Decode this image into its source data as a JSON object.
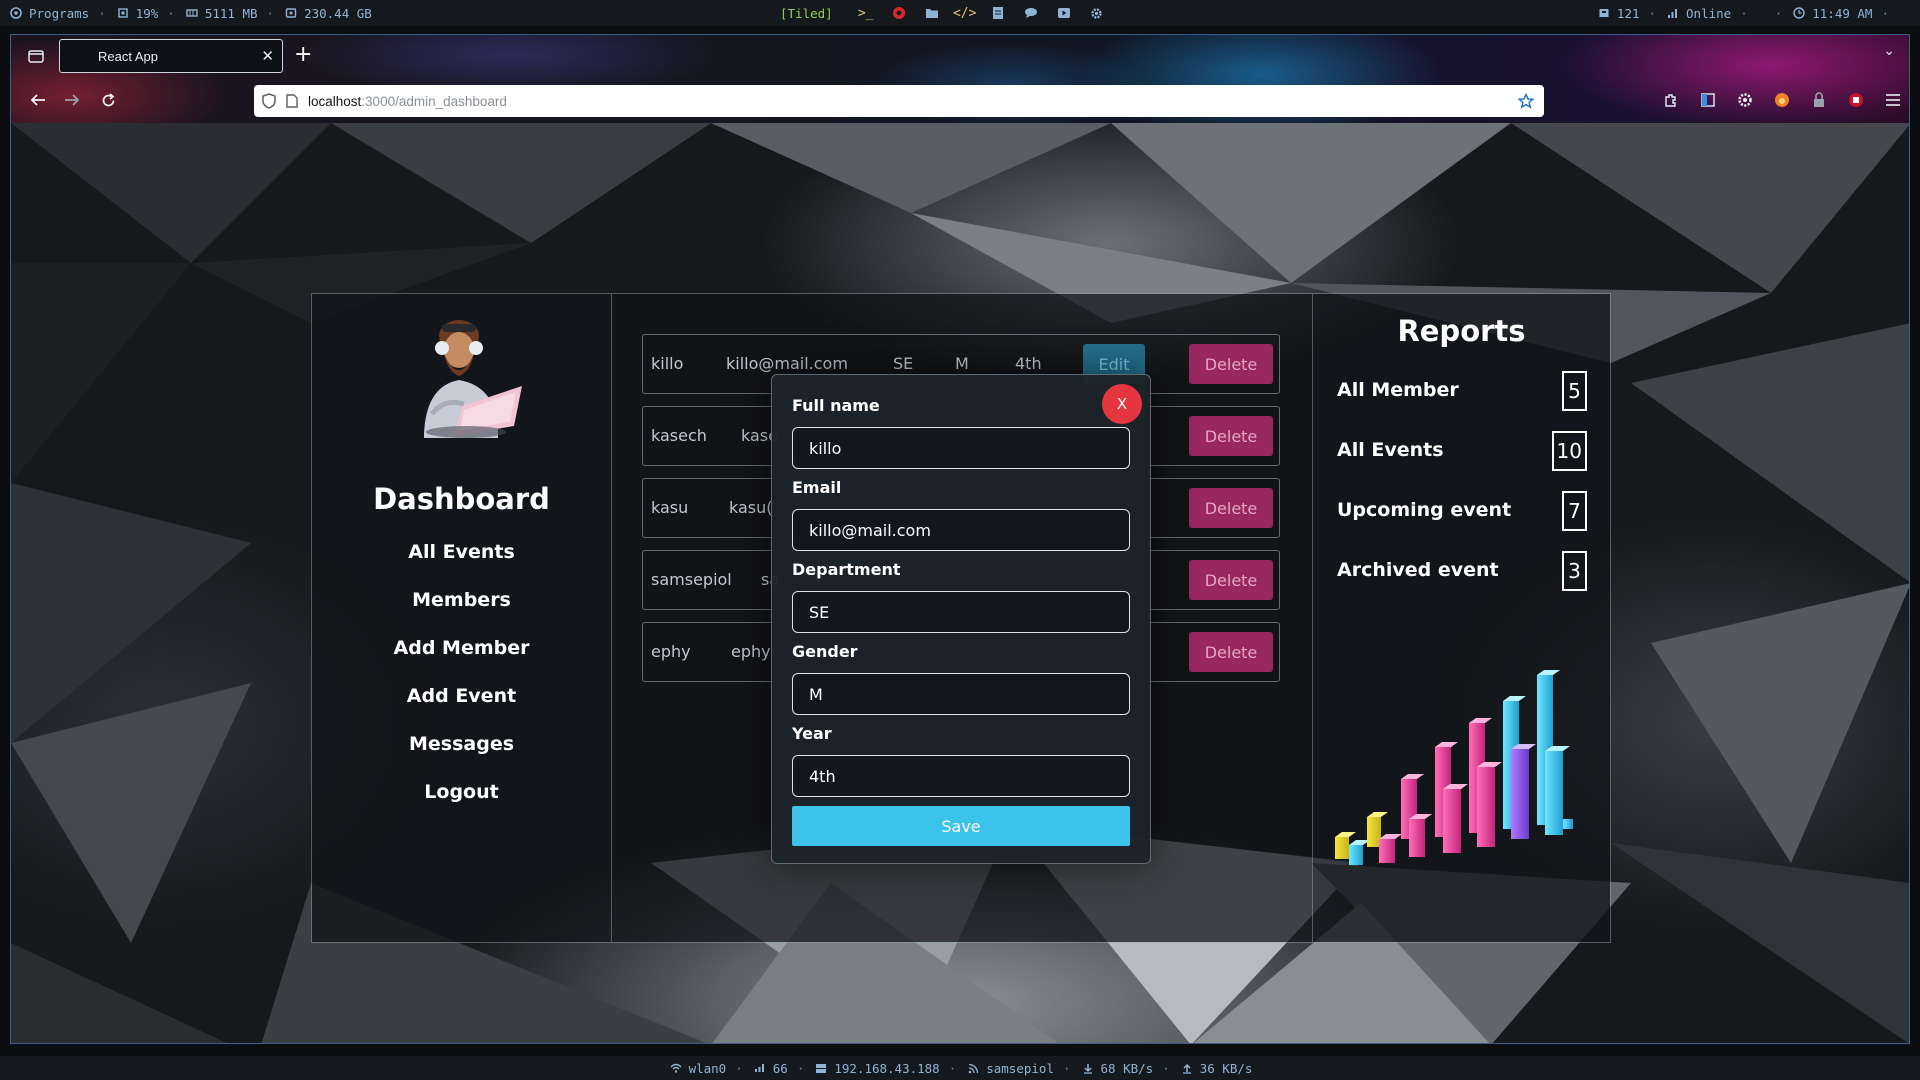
{
  "system_bar": {
    "programs": "Programs",
    "cpu": "19%",
    "memory": "5111 MB",
    "disk": "230.44 GB",
    "layout_mode": "[Tiled]",
    "updates": "121",
    "network_status": "Online",
    "time": "11:49 AM"
  },
  "browser": {
    "tab_title": "React App",
    "url_host": "localhost",
    "url_path": ":3000/admin_dashboard"
  },
  "sidebar": {
    "title": "Dashboard",
    "items": [
      "All Events",
      "Members",
      "Add Member",
      "Add Event",
      "Messages",
      "Logout"
    ]
  },
  "members": {
    "edit_label": "Edit",
    "delete_label": "Delete",
    "rows": [
      {
        "name": "killo",
        "email": "killo@mail.com",
        "department": "SE",
        "gender": "M",
        "year": "4th"
      },
      {
        "name": "kasech",
        "email": "kase"
      },
      {
        "name": "kasu",
        "email": "kasu("
      },
      {
        "name": "samsepiol",
        "email": "sa"
      },
      {
        "name": "ephy",
        "email": "ephy"
      }
    ]
  },
  "modal": {
    "close_label": "X",
    "fields": [
      {
        "label": "Full name",
        "value": "killo"
      },
      {
        "label": "Email",
        "value": "killo@mail.com"
      },
      {
        "label": "Department",
        "value": "SE"
      },
      {
        "label": "Gender",
        "value": "M"
      },
      {
        "label": "Year",
        "value": "4th"
      }
    ],
    "save_label": "Save"
  },
  "reports": {
    "title": "Reports",
    "stats": [
      {
        "label": "All Member",
        "value": "5"
      },
      {
        "label": "All Events",
        "value": "10"
      },
      {
        "label": "Upcoming event",
        "value": "7"
      },
      {
        "label": "Archived event",
        "value": "3"
      }
    ]
  },
  "status_bar": {
    "interface": "wlan0",
    "signal": "66",
    "ip": "192.168.43.188",
    "ssid": "samsepiol",
    "download": "68 KB/s",
    "upload": "36 KB/s"
  },
  "colors": {
    "edit_button": "#288cb4",
    "delete_button": "#98285f",
    "save_button": "#3cc3ea",
    "close_button": "#e5363f"
  }
}
